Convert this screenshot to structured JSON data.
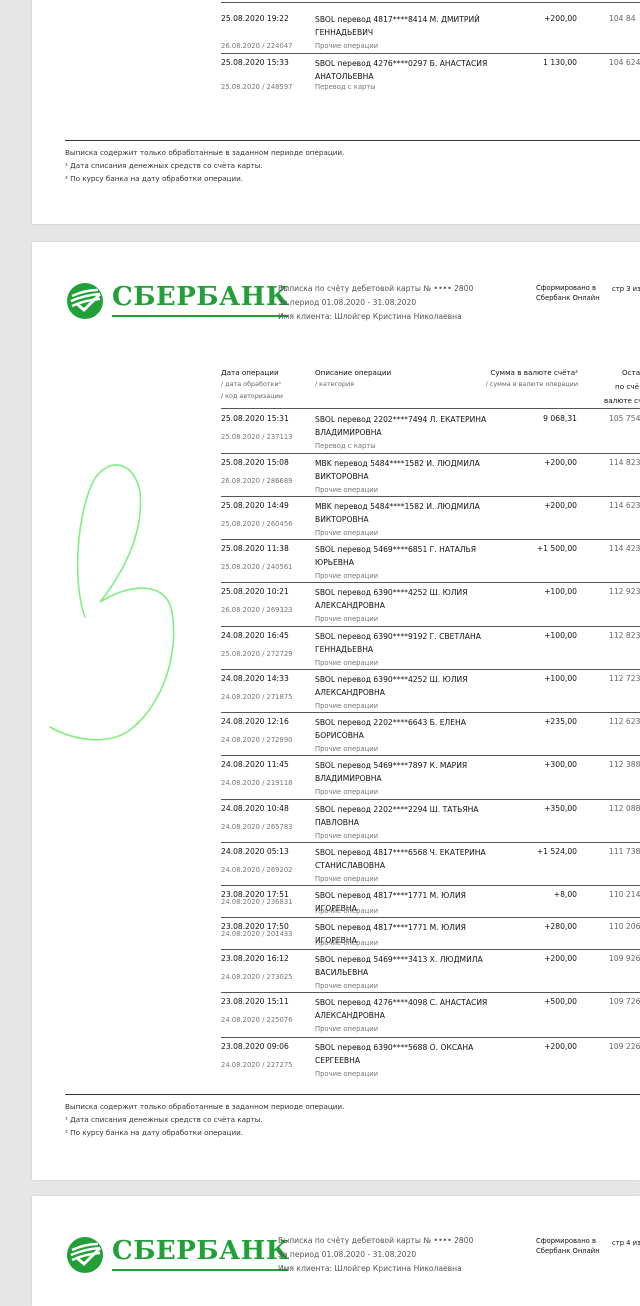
{
  "bank": {
    "name": "СБЕРБАНК",
    "brand_color": "#21a038"
  },
  "prev_page": {
    "rows": [
      {
        "date": "25.08.2020 19:22",
        "desc1": "SBOL перевод 4817****8414 М. ДМИТРИЙ",
        "desc2": "ГЕННАДЬЕВИЧ",
        "date2": "26.08.2020 / 224047",
        "category": "Прочие операции",
        "amount": "+200,00",
        "balance": "104 84"
      },
      {
        "date": "25.08.2020 15:33",
        "desc1": "SBOL перевод 4276****0297 Б. АНАСТАСИЯ",
        "desc2": "АНАТОЛЬЕВНА",
        "date2": "25.08.2020 / 248597",
        "category": "Перевод с карты",
        "amount": "1 130,00",
        "balance": "104 624"
      }
    ]
  },
  "footer": {
    "note": "Выписка содержит только обработанные в заданном периоде операции.",
    "fn1": "¹ Дата списания денежных средств со счёта карты.",
    "fn2": "² По курсу банка на дату обработки операции."
  },
  "header": {
    "account_line": "Выписка по счёту дебетовой карты № •••• 2800",
    "period_line": "За период 01.08.2020 - 31.08.2020",
    "client_line": "Имя клиента: Шлойгер Кристина Николаевна",
    "generated_line1": "Сформировано в",
    "generated_line2": "Сбербанк Онлайн"
  },
  "page2": {
    "page_label": "стр 3 из"
  },
  "page3": {
    "page_label": "стр 4 из"
  },
  "table_headers": {
    "date": "Дата операции",
    "date_sub1": "/ дата обработки¹",
    "date_sub2": "/ код авторизации",
    "desc": "Описание операции",
    "desc_sub": "/ категория",
    "amount": "Сумма в валюте счёта²",
    "amount_sub": "/ сумма в валюте операции",
    "balance1": "Оста",
    "balance2": "по счё",
    "balance3": "валюте сч"
  },
  "rows": [
    {
      "date": "25.08.2020 15:31",
      "desc1": "SBOL перевод 2202****7494 Л. ЕКАТЕРИНА",
      "desc2": "ВЛАДИМИРОВНА",
      "date2": "25.08.2020 / 237113",
      "category": "Перевод с карты",
      "amount": "9 068,31",
      "balance": "105 754"
    },
    {
      "date": "25.08.2020 15:08",
      "desc1": "MBK перевод 5484****1582 И. ЛЮДМИЛА",
      "desc2": "ВИКТОРОВНА",
      "date2": "26.08.2020 / 286689",
      "category": "Прочие операции",
      "amount": "+200,00",
      "balance": "114 823"
    },
    {
      "date": "25.08.2020 14:49",
      "desc1": "MBK перевод 5484****1582 И. ЛЮДМИЛА",
      "desc2": "ВИКТОРОВНА",
      "date2": "25.08.2020 / 260456",
      "category": "Прочие операции",
      "amount": "+200,00",
      "balance": "114 623"
    },
    {
      "date": "25.08.2020 11:38",
      "desc1": "SBOL перевод 5469****6851 Г. НАТАЛЬЯ",
      "desc2": "ЮРЬЕВНА",
      "date2": "25.08.2020 / 240561",
      "category": "Прочие операции",
      "amount": "+1 500,00",
      "balance": "114 423"
    },
    {
      "date": "25.08.2020 10:21",
      "desc1": "SBOL перевод 6390****4252 Ш. ЮЛИЯ",
      "desc2": "АЛЕКСАНДРОВНА",
      "date2": "26.08.2020 / 269323",
      "category": "Прочие операции",
      "amount": "+100,00",
      "balance": "112 923"
    },
    {
      "date": "24.08.2020 16:45",
      "desc1": "SBOL перевод 6390****9192 Г. СВЕТЛАНА",
      "desc2": "ГЕННАДЬЕВНА",
      "date2": "25.08.2020 / 272729",
      "category": "Прочие операции",
      "amount": "+100,00",
      "balance": "112 823"
    },
    {
      "date": "24.08.2020 14:33",
      "desc1": "SBOL перевод 6390****4252 Ш. ЮЛИЯ",
      "desc2": "АЛЕКСАНДРОВНА",
      "date2": "24.08.2020 / 271875",
      "category": "Прочие операции",
      "amount": "+100,00",
      "balance": "112 723"
    },
    {
      "date": "24.08.2020 12:16",
      "desc1": "SBOL перевод 2202****6643 Б. ЕЛЕНА",
      "desc2": "БОРИСОВНА",
      "date2": "24.08.2020 / 272890",
      "category": "Прочие операции",
      "amount": "+235,00",
      "balance": "112 623"
    },
    {
      "date": "24.08.2020 11:45",
      "desc1": "SBOL перевод 5469****7897 К. МАРИЯ",
      "desc2": "ВЛАДИМИРОВНА",
      "date2": "24.08.2020 / 219118",
      "category": "Прочие операции",
      "amount": "+300,00",
      "balance": "112 388"
    },
    {
      "date": "24.08.2020 10:48",
      "desc1": "SBOL перевод 2202****2294 Ш. ТАТЬЯНА",
      "desc2": "ПАВЛОВНА",
      "date2": "24.08.2020 / 265783",
      "category": "Прочие операции",
      "amount": "+350,00",
      "balance": "112 088"
    },
    {
      "date": "24.08.2020 05:13",
      "desc1": "SBOL перевод 4817****6568 Ч. ЕКАТЕРИНА",
      "desc2": "СТАНИСЛАВОВНА",
      "date2": "24.08.2020 / 269202",
      "category": "Прочие операции",
      "amount": "+1 524,00",
      "balance": "111 738"
    },
    {
      "date": "23.08.2020 17:51",
      "desc1": "SBOL перевод 4817****1771 М. ЮЛИЯ ИГОРЕВНА",
      "desc2": "",
      "date2": "24.08.2020 / 236831",
      "category": "Прочие операции",
      "amount": "+8,00",
      "balance": "110 214"
    },
    {
      "date": "23.08.2020 17:50",
      "desc1": "SBOL перевод 4817****1771 М. ЮЛИЯ ИГОРЕВНА",
      "desc2": "",
      "date2": "24.08.2020 / 201433",
      "category": "Прочие операции",
      "amount": "+280,00",
      "balance": "110 206"
    },
    {
      "date": "23.08.2020 16:12",
      "desc1": "SBOL перевод 5469****3413 Х. ЛЮДМИЛА",
      "desc2": "ВАСИЛЬЕВНА",
      "date2": "24.08.2020 / 273025",
      "category": "Прочие операции",
      "amount": "+200,00",
      "balance": "109 926"
    },
    {
      "date": "23.08.2020 15:11",
      "desc1": "SBOL перевод 4276****4098 С. АНАСТАСИЯ",
      "desc2": "АЛЕКСАНДРОВНА",
      "date2": "24.08.2020 / 225076",
      "category": "Прочие операции",
      "amount": "+500,00",
      "balance": "109 726"
    },
    {
      "date": "23.08.2020 09:06",
      "desc1": "SBOL перевод 6390****5688 О. ОКСАНА",
      "desc2": "СЕРГЕЕВНА",
      "date2": "24.08.2020 / 227275",
      "category": "Прочие операции",
      "amount": "+200,00",
      "balance": "109 226"
    }
  ],
  "annotation": {
    "mark": "3",
    "color": "#7ef07e"
  }
}
